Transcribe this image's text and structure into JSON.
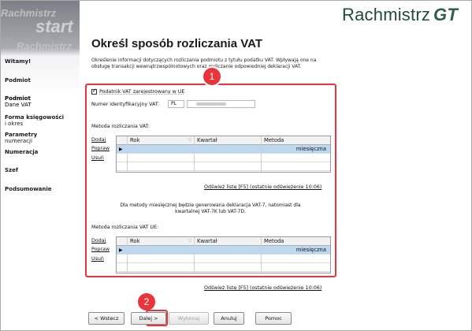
{
  "app": {
    "logo_text": "Rachmistrz",
    "logo_suffix": "GT"
  },
  "watermark": {
    "w1": "Rachmistrz",
    "w2": "start",
    "w3": "Rachmistrz"
  },
  "sidebar": {
    "items": [
      {
        "label": "Witamy!",
        "sub": ""
      },
      {
        "label": "Podmiot",
        "sub": ""
      },
      {
        "label": "Podmiot",
        "sub": "Dane VAT"
      },
      {
        "label": "Forma księgowości",
        "sub": "i okres"
      },
      {
        "label": "Parametry",
        "sub": "numeracji"
      },
      {
        "label": "Numeracja",
        "sub": ""
      },
      {
        "label": "Szef",
        "sub": ""
      },
      {
        "label": "Podsumowanie",
        "sub": ""
      }
    ]
  },
  "page": {
    "title": "Określ sposób rozliczania VAT",
    "description": "Określenie informacji dotyczących rozliczania podmiotu z tytułu podatku VAT. Wpływają one na obsługę transakcji wewnątrzwspólnotowych oraz wyliczanie odpowiedniej deklaracji VAT."
  },
  "badges": {
    "one": "1",
    "two": "2"
  },
  "vat": {
    "registered_label": "Podatnik VAT zarejestrowany w UE",
    "registered_checked": true,
    "nip_label": "Numer identyfikacyjny VAT:",
    "nip_prefix": "PL",
    "method_label": "Metoda rozliczania VAT:",
    "method_ue_label": "Metoda rozliczania VAT UE:",
    "actions": {
      "add": "Dodaj",
      "edit": "Popraw",
      "remove": "Usuń"
    },
    "columns": {
      "year": "Rok",
      "quarter": "Kwartał",
      "method": "Metoda"
    },
    "row_method": "miesięczna",
    "refresh_link": "Odśwież listę [F5] (ostatnie odświeżenie 10:06)",
    "note": "Dla metody miesięcznej będzie generowana deklaracja VAT-7, natomiast dla kwartalnej VAT-7K lub VAT-7D."
  },
  "buttons": {
    "back": "< Wstecz",
    "next": "Dalej >",
    "execute": "Wykonaj",
    "cancel": "Anuluj",
    "help": "Pomoc"
  },
  "colors": {
    "accent_red": "#e8343a",
    "selection": "#bcd8f0",
    "logo": "#1f4a3b"
  }
}
